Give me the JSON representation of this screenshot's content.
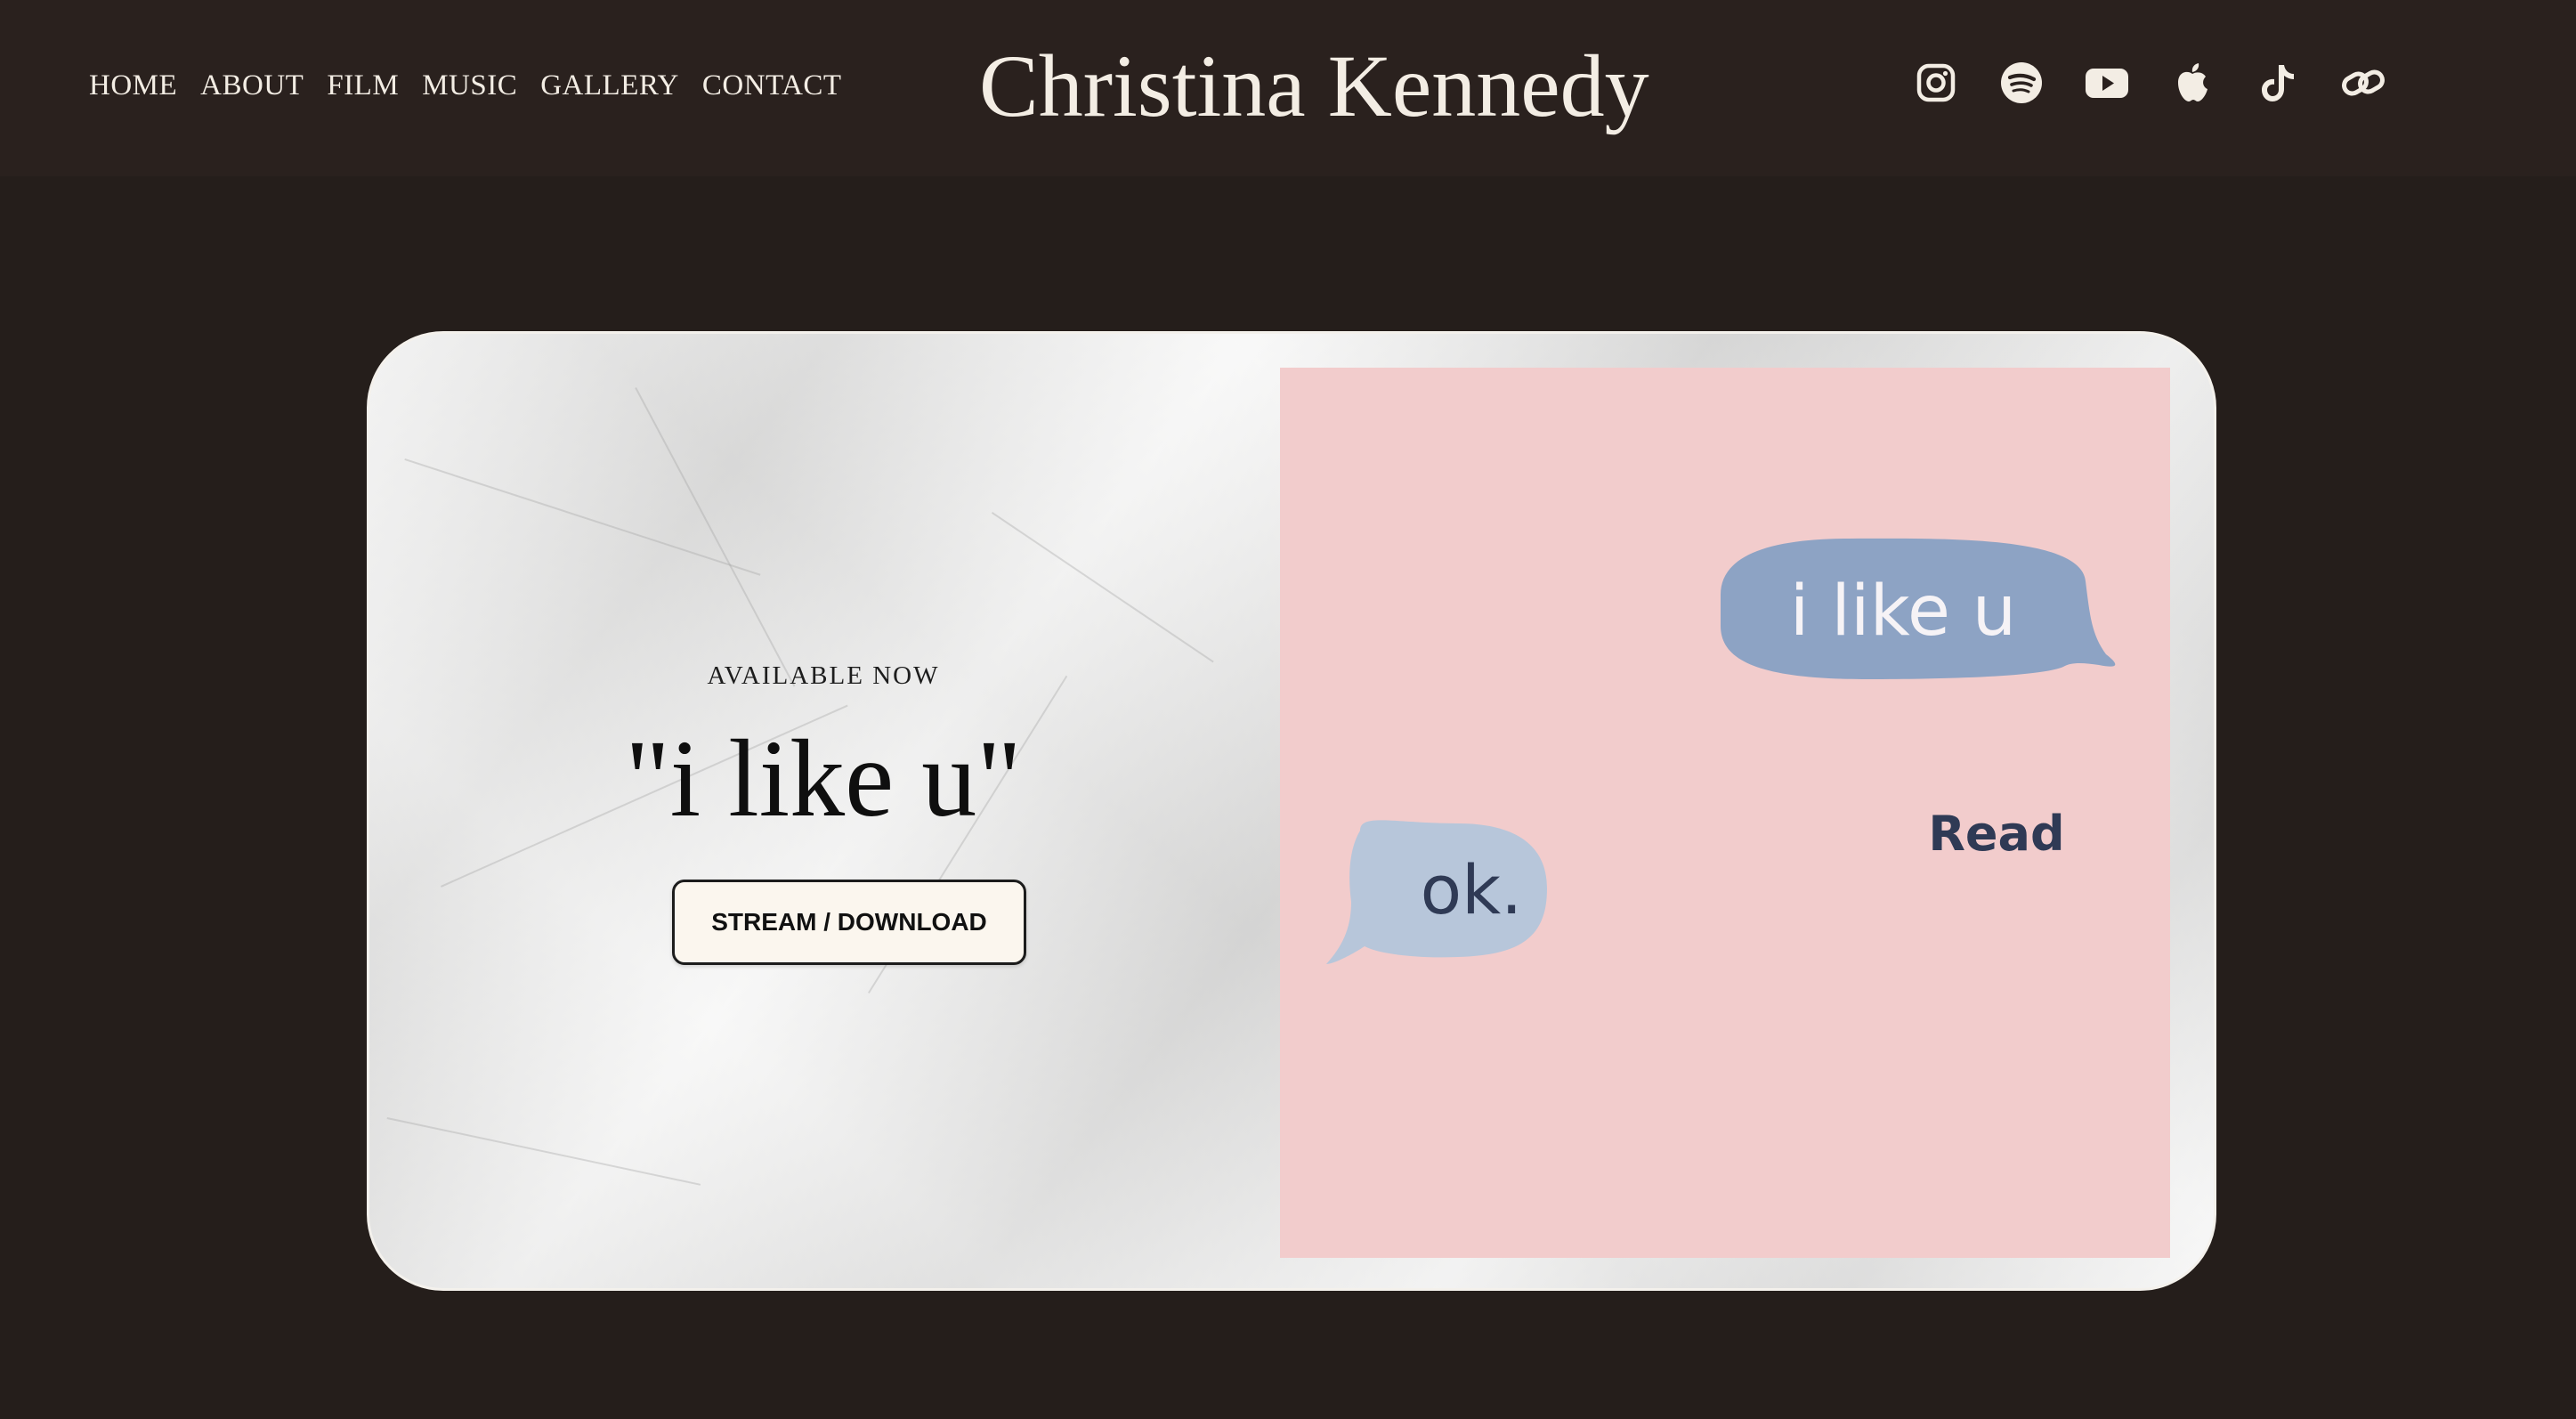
{
  "header": {
    "nav": [
      {
        "label": "HOME"
      },
      {
        "label": "ABOUT"
      },
      {
        "label": "FILM"
      },
      {
        "label": "MUSIC"
      },
      {
        "label": "GALLERY"
      },
      {
        "label": "CONTACT"
      }
    ],
    "site_title": "Christina Kennedy",
    "social_icons": [
      "instagram-icon",
      "spotify-icon",
      "youtube-icon",
      "apple-music-icon",
      "tiktok-icon",
      "link-icon"
    ]
  },
  "hero": {
    "eyebrow": "AVAILABLE NOW",
    "title": "\"i like u\"",
    "cta_label": "STREAM / DOWNLOAD",
    "artwork": {
      "bubble_sent": "i like u",
      "receipt": "Read",
      "bubble_received": "ok."
    }
  },
  "colors": {
    "page_bg": "#251e1b",
    "header_bg": "#2a211e",
    "text_light": "#f3ede4",
    "artwork_bg": "#f2cccc",
    "bubble_sent": "#8da3c4",
    "bubble_received": "#b7c6da",
    "ink_dark": "#2f3a55"
  }
}
